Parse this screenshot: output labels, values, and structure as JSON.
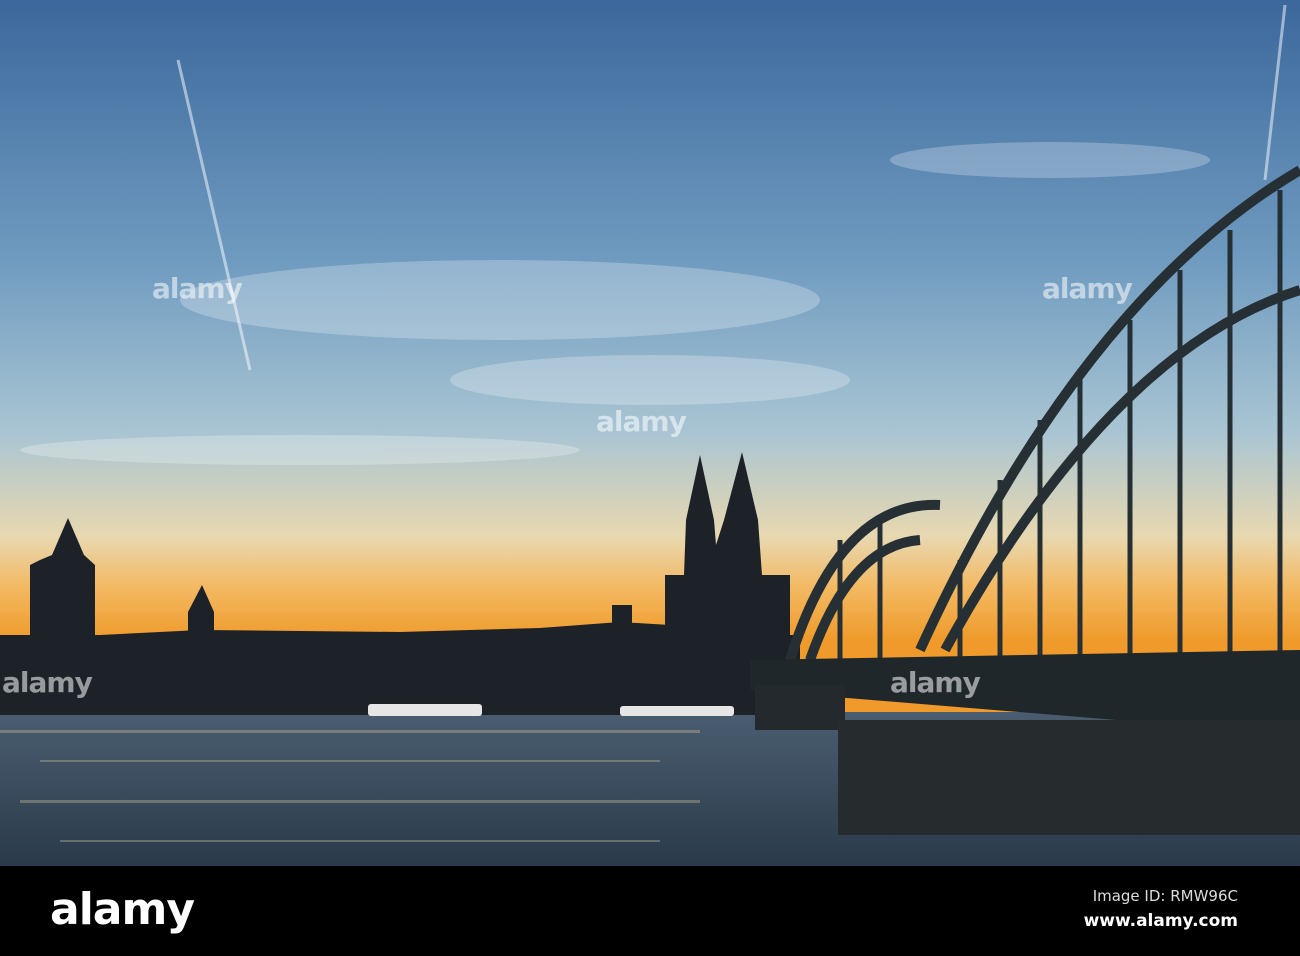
{
  "photo": {
    "subject": "Cologne skyline at sunset with cathedral and Hohenzollern Bridge over the Rhine",
    "colors": {
      "sky_top": "#3d6a9e",
      "sky_mid": "#9dbccf",
      "horizon": "#f3a53a",
      "water": "#34475a",
      "silhouette": "#1c2228"
    }
  },
  "watermark": {
    "text": "alamy"
  },
  "footer": {
    "logo": "alamy",
    "image_id": "Image ID: RMW96C",
    "url": "www.alamy.com"
  }
}
